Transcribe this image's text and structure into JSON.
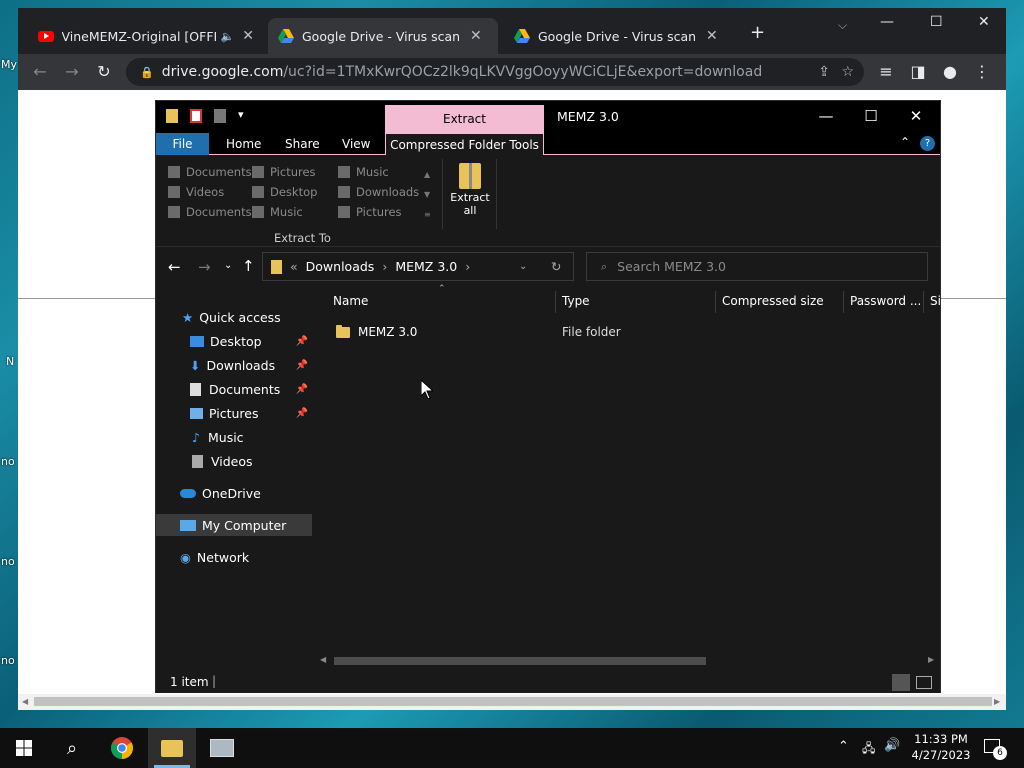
{
  "desktop": {
    "labels": [
      "My",
      "no",
      "no",
      "no",
      "N"
    ]
  },
  "chrome": {
    "tabs": [
      {
        "title": "VineMEMZ-Original [OFFICIAL",
        "close": "✕"
      },
      {
        "title": "Google Drive - Virus scan warning",
        "close": "✕"
      },
      {
        "title": "Google Drive - Virus scan warning",
        "close": "✕"
      }
    ],
    "new_tab": "+",
    "url_host": "drive.google.com",
    "url_path": "/uc?id=1TMxKwrQOCz2lk9qLKVVggOoyyWCiCLjE&export=download"
  },
  "explorer": {
    "context_tab": "Extract",
    "window_title": "MEMZ 3.0",
    "ribbon_tabs": {
      "file": "File",
      "home": "Home",
      "share": "Share",
      "view": "View",
      "compressed": "Compressed Folder Tools"
    },
    "extract_to_items": [
      [
        "Documents",
        "Pictures",
        "Music"
      ],
      [
        "Videos",
        "Desktop",
        "Downloads"
      ],
      [
        "Documents",
        "Music",
        "Pictures"
      ]
    ],
    "extract_all": "Extract all",
    "extract_to_label": "Extract To",
    "breadcrumb": {
      "prefix": "«",
      "part1": "Downloads",
      "sep": "›",
      "part2": "MEMZ 3.0"
    },
    "search_placeholder": "Search MEMZ 3.0",
    "sidebar": {
      "quick_access": "Quick access",
      "items": [
        "Desktop",
        "Downloads",
        "Documents",
        "Pictures",
        "Music",
        "Videos"
      ],
      "onedrive": "OneDrive",
      "my_computer": "My Computer",
      "network": "Network"
    },
    "columns": [
      "Name",
      "Type",
      "Compressed size",
      "Password ...",
      "Si"
    ],
    "files": [
      {
        "name": "MEMZ 3.0",
        "type": "File folder"
      }
    ],
    "status": "1 item"
  },
  "taskbar": {
    "time": "11:33 PM",
    "date": "4/27/2023",
    "notifications": "6"
  },
  "colors": {
    "accent_pink": "#f3bcd2",
    "file_tab_blue": "#1f6fae",
    "chrome_dark": "#202124"
  }
}
